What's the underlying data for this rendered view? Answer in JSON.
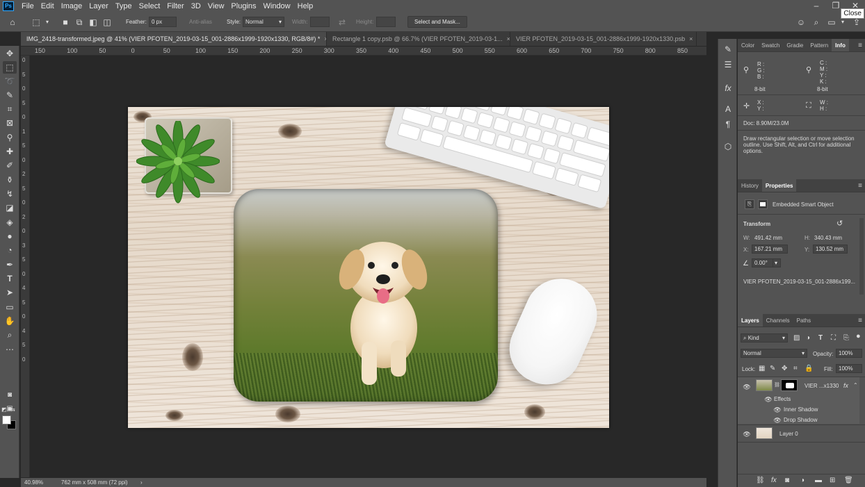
{
  "app": {
    "logo_text": "Ps",
    "menu": [
      "File",
      "Edit",
      "Image",
      "Layer",
      "Type",
      "Select",
      "Filter",
      "3D",
      "View",
      "Plugins",
      "Window",
      "Help"
    ],
    "tooltip_close": "Close"
  },
  "options": {
    "feather_label": "Feather:",
    "feather_value": "0 px",
    "antialias_label": "Anti-alias",
    "style_label": "Style:",
    "style_value": "Normal",
    "width_label": "Width:",
    "height_label": "Height:",
    "select_mask_label": "Select and Mask..."
  },
  "tabs": [
    {
      "label": "IMG_2418-transformed.jpeg @ 41% (VIER PFOTEN_2019-03-15_001-2886x1999-1920x1330, RGB/8#) *",
      "close": "×"
    },
    {
      "label": "Rectangle 1 copy.psb @ 66.7% (VIER PFOTEN_2019-03-1...",
      "close": "×"
    },
    {
      "label": "VIER PFOTEN_2019-03-15_001-2886x1999-1920x1330.psb",
      "close": "×"
    }
  ],
  "ruler_top": [
    "150",
    "100",
    "50",
    "0",
    "50",
    "100",
    "150",
    "200",
    "250",
    "300",
    "350",
    "400",
    "450",
    "500",
    "550",
    "600",
    "650",
    "700",
    "750",
    "800",
    "850",
    "900"
  ],
  "ruler_left": [
    "0",
    "5",
    "0",
    "5",
    "0",
    "1",
    "5",
    "0",
    "2",
    "5",
    "0",
    "2",
    "0",
    "3",
    "5",
    "0",
    "4",
    "5",
    "0",
    "4",
    "5",
    "0"
  ],
  "status": {
    "zoom": "40.98%",
    "doc_size": "762 mm x 508 mm (72 ppi)",
    "arrow": "›"
  },
  "info_panel": {
    "tabs": [
      "Color",
      "Swatch",
      "Gradie",
      "Pattern",
      "Info"
    ],
    "rgb": [
      "R :",
      "G :",
      "B :"
    ],
    "cmyk": [
      "C :",
      "M :",
      "Y :",
      "K :"
    ],
    "bit_left": "8-bit",
    "bit_right": "8-bit",
    "xy": [
      "X :",
      "Y :"
    ],
    "wh": [
      "W :",
      "H :"
    ],
    "doc": "Doc: 8.90M/23.0M",
    "hint": [
      "Draw rectangular selection or move selection",
      "outline.  Use Shift, Alt, and Ctrl for additional",
      "options."
    ]
  },
  "properties_panel": {
    "tabs": [
      "History",
      "Properties"
    ],
    "object_type": "Embedded Smart Object",
    "section": "Transform",
    "w_label": "W:",
    "w_value": "491.42 mm",
    "h_label": "H:",
    "h_value": "340.43 mm",
    "x_label": "X:",
    "x_value": "167.21 mm",
    "y_label": "Y:",
    "y_value": "130.52 mm",
    "angle_value": "0.00°",
    "source_name": "VIER  PFOTEN_2019-03-15_001-2886x199..."
  },
  "layers_panel": {
    "tabs": [
      "Layers",
      "Channels",
      "Paths"
    ],
    "kind_label": "Kind",
    "blend_mode": "Normal",
    "opacity_label": "Opacity:",
    "opacity_value": "100%",
    "lock_label": "Lock:",
    "fill_label": "Fill:",
    "fill_value": "100%",
    "layers": [
      {
        "name": "VIER ...x1330",
        "fx": "fx",
        "effects_label": "Effects",
        "effects": [
          "Inner Shadow",
          "Drop Shadow"
        ]
      },
      {
        "name": "Layer 0"
      }
    ],
    "bottom_icons": [
      "link-icon",
      "fx-icon",
      "mask-icon",
      "adjustment-icon",
      "folder-icon",
      "new-layer-icon",
      "trash-icon"
    ],
    "fx_glyph": "fx"
  }
}
